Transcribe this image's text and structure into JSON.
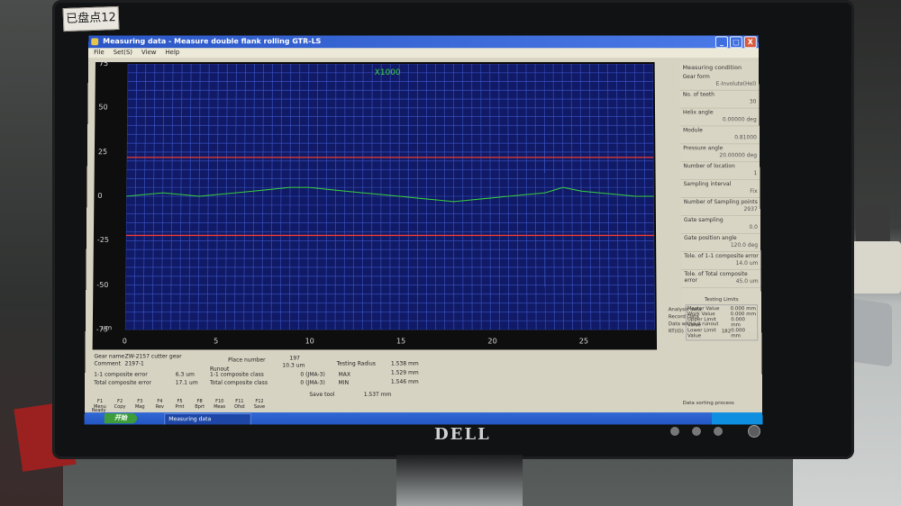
{
  "environment": {
    "sticker_text": "已盘点12",
    "monitor_brand": "DELL"
  },
  "window": {
    "title": "Measuring data - Measure double flank rolling GTR-LS",
    "menu": [
      "File",
      "Set(S)",
      "View",
      "Help"
    ],
    "controls": [
      "_",
      "□",
      "X"
    ]
  },
  "plot": {
    "magnification": "X1000",
    "y_unit": "um",
    "background": "#101a66",
    "grid_color": "#3d56c8",
    "trace_color": "#39d23c",
    "limit_color": "#e23a32"
  },
  "chart_data": {
    "type": "line",
    "ylim": [
      -75,
      75
    ],
    "xlim": [
      0,
      29
    ],
    "y_ticks": [
      "75",
      "50",
      "25",
      "0",
      "-25",
      "-50",
      "-75"
    ],
    "x_ticks": [
      "0",
      "5",
      "10",
      "15",
      "20",
      "25"
    ],
    "ylabel": "um",
    "limits": [
      22,
      -22
    ],
    "series": [
      {
        "x": [
          0,
          1,
          2,
          3,
          4,
          5,
          6,
          7,
          8,
          9,
          10,
          11,
          12,
          13,
          14,
          15,
          16,
          17,
          18,
          19,
          20,
          21,
          22,
          23,
          24,
          25,
          26,
          27,
          28,
          29
        ],
        "values": [
          0,
          1,
          2,
          1,
          0,
          1,
          2,
          3,
          4,
          5,
          5,
          4,
          3,
          2,
          1,
          0,
          -1,
          -2,
          -3,
          -2,
          -1,
          0,
          1,
          2,
          5,
          3,
          2,
          1,
          0,
          0
        ]
      }
    ]
  },
  "conditions": {
    "title": "Measuring condition",
    "items": [
      {
        "label": "Gear form",
        "value": "E-Involute(Hel)"
      },
      {
        "label": "No. of teeth",
        "value": "30"
      },
      {
        "label": "Helix angle",
        "value": "0.00000 deg"
      },
      {
        "label": "Module",
        "value": "0.81000"
      },
      {
        "label": "Pressure angle",
        "value": "20.00000 deg"
      },
      {
        "label": "Number of location",
        "value": "1"
      },
      {
        "label": "Sampling interval",
        "value": "Fix"
      },
      {
        "label": "Number of Sampling points",
        "value": "2937"
      },
      {
        "label": "Gate sampling",
        "value": "0.0"
      },
      {
        "label": "Gate position angle",
        "value": "120.0 deg"
      },
      {
        "label": "Tole. of 1-1 composite error",
        "value": "14.0 um"
      },
      {
        "label": "Tole. of Total composite error",
        "value": "45.0 um"
      }
    ]
  },
  "testing_limits": {
    "title": "Testing Limits",
    "rows": [
      {
        "label": "Master Value",
        "value": "0.000 mm"
      },
      {
        "label": "Work Value",
        "value": "0.000 mm"
      },
      {
        "label": "Upper Limit Value",
        "value": "0.000 mm"
      },
      {
        "label": "Lower Limit Value",
        "value": "0.000 mm"
      }
    ]
  },
  "analysis": {
    "lines": [
      "Analysis data",
      "Record Data",
      "Data without runout"
    ],
    "id": "RT(ID)",
    "id_value": "182"
  },
  "info": {
    "gear_name_label": "Gear name",
    "gear_name": "ZW-2157 cutter gear",
    "comment_label": "Comment",
    "comment": "2197-1",
    "place_label": "Place number",
    "place_value": "197",
    "runout_value": "10.3 um",
    "runout_label": "Runout",
    "t_composite_label": "1-1 composite error",
    "t_composite_value": "6.3 um",
    "total_composite_label": "Total composite error",
    "total_composite_value": "17.1 um",
    "class_11": "1-1 composite class",
    "class_total": "Total composite class",
    "class_11_value": "0 (JMA-3)",
    "class_total_value": "0 (JMA-3)",
    "testing_radius_label": "Testing Radius",
    "testing_radius_value": "1.538 mm",
    "max_label": "MAX",
    "max_value": "1.529 mm",
    "min_label": "MIN",
    "min_value": "1.546 mm"
  },
  "toolbar": [
    {
      "key": "F1",
      "label": "Menu"
    },
    {
      "key": "F2",
      "label": "Copy"
    },
    {
      "key": "F3",
      "label": "Mag"
    },
    {
      "key": "F4",
      "label": "Rev"
    },
    {
      "key": "F5",
      "label": "Prnt"
    },
    {
      "key": "F8",
      "label": "Bprt"
    },
    {
      "key": "F10",
      "label": "Meas"
    },
    {
      "key": "F11",
      "label": "Ofsd"
    },
    {
      "key": "F12",
      "label": "Save"
    }
  ],
  "status": {
    "save_label": "Save tool",
    "save_value": "1.53T mm",
    "right": "Data sorting process",
    "ready": "Ready"
  },
  "taskbar": {
    "start": "开始",
    "item": "Measuring data"
  }
}
